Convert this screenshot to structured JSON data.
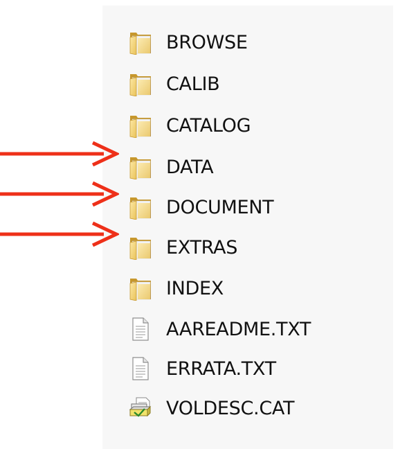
{
  "accent_color": "#ee3019",
  "items": [
    {
      "name": "BROWSE",
      "icon": "folder-icon"
    },
    {
      "name": "CALIB",
      "icon": "folder-icon"
    },
    {
      "name": "CATALOG",
      "icon": "folder-icon"
    },
    {
      "name": "DATA",
      "icon": "folder-icon"
    },
    {
      "name": "DOCUMENT",
      "icon": "folder-icon"
    },
    {
      "name": "EXTRAS",
      "icon": "folder-icon"
    },
    {
      "name": "INDEX",
      "icon": "folder-icon"
    },
    {
      "name": "AAREADME.TXT",
      "icon": "text-file-icon"
    },
    {
      "name": "ERRATA.TXT",
      "icon": "text-file-icon"
    },
    {
      "name": "VOLDESC.CAT",
      "icon": "catalog-file-icon"
    }
  ]
}
